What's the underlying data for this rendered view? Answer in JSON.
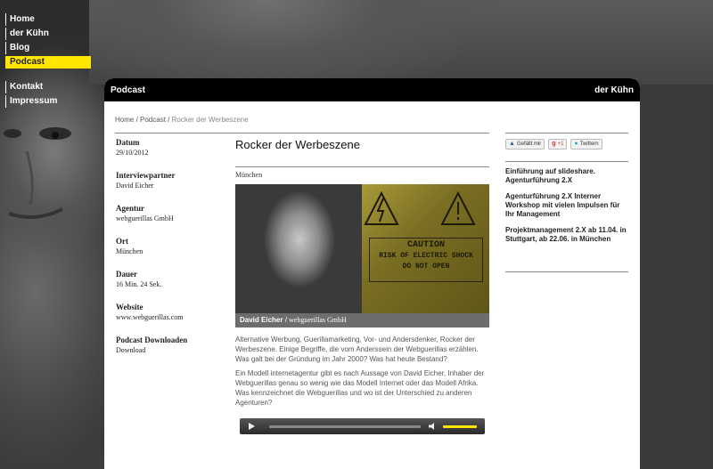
{
  "nav": {
    "items": [
      {
        "label": "Home",
        "active": false
      },
      {
        "label": "der Kühn",
        "active": false
      },
      {
        "label": "Blog",
        "active": false
      },
      {
        "label": "Podcast",
        "active": true
      }
    ],
    "secondary": [
      {
        "label": "Kontakt"
      },
      {
        "label": "Impressum"
      }
    ]
  },
  "header": {
    "left": "Podcast",
    "right": "der Kühn"
  },
  "breadcrumb": {
    "home": "Home",
    "sep1": " / ",
    "section": "Podcast",
    "sep2": " / ",
    "current": "Rocker der Werbeszene"
  },
  "meta": [
    {
      "label": "Datum",
      "value": "29/10/2012"
    },
    {
      "label": "Interviewpartner",
      "value": "David Eicher"
    },
    {
      "label": "Agentur",
      "value": "webguerillas GmbH"
    },
    {
      "label": "Ort",
      "value": "München"
    },
    {
      "label": "Dauer",
      "value": "16 Min. 24 Sek."
    },
    {
      "label": "Website",
      "value": "www.webguerillas.com"
    },
    {
      "label": "Podcast Downloaden",
      "value": "Download"
    }
  ],
  "article": {
    "title": "Rocker der Werbeszene",
    "city": "München",
    "photo_sign": [
      "CAUTION",
      "RISK OF ELECTRIC SHOCK",
      "DO NOT OPEN"
    ],
    "caption_name": "David Eicher",
    "caption_sep": " / ",
    "caption_org": "webguerillas GmbH",
    "para1": "Alternative Werbung, Guerillamarketing, Vor- und Andersdenker, Rocker der Werbeszene. Einige Begriffe, die vom Anderssein der Webguerillas erzählen. Was galt bei der Gründung im Jahr 2000? Was hat heute Bestand?",
    "para2": "Ein Modell internetagentur gibt es nach Aussage von David Eicher, Inhaber der Webguerillas genau so wenig wie das Modell Internet oder das Modell Afrika. Was kennzeichnet die Webguerillas und wo ist der Unterschied zu anderen Agenturen?"
  },
  "player": {
    "volume": 1.0
  },
  "share": {
    "like": "Gefällt mir",
    "gplus": "+1",
    "twitter": "Twittern"
  },
  "sidebar_links": [
    "Einführung auf slideshare. Agenturführung 2.X",
    "Agenturführung 2.X  Interner Workshop mit vielen Impulsen für Ihr Management",
    "Projektmanagement 2.X  ab 11.04. in Stuttgart, ab 22.06. in München"
  ],
  "colors": {
    "accent": "#ffe600",
    "header_bg": "#000000"
  }
}
